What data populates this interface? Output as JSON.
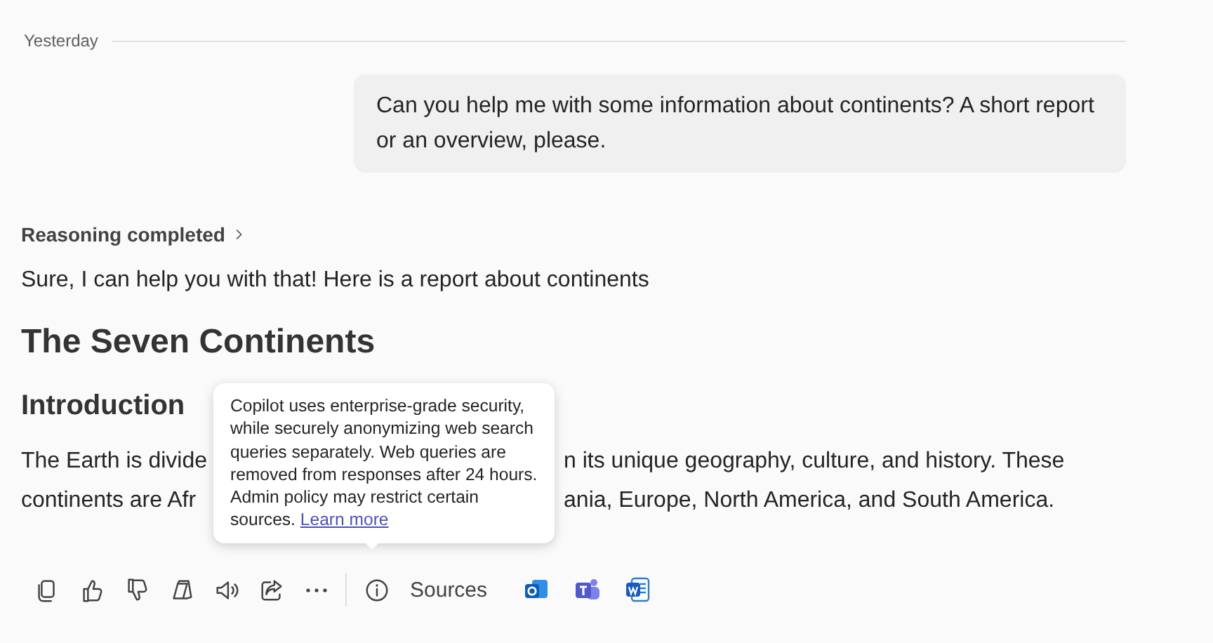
{
  "date_divider": "Yesterday",
  "user_message": "Can you help me with some information about continents? A short report or an overview, please.",
  "reasoning": {
    "label": "Reasoning completed",
    "expanded": false
  },
  "reply": {
    "intro": "Sure, I can help you with that! Here is a report about continents",
    "title": "The Seven Continents",
    "section_heading": "Introduction",
    "paragraph_lines": [
      {
        "left": "The Earth is divide",
        "right": "n its unique geography, culture, and history. These"
      },
      {
        "left": "continents are Afr",
        "right": "ania, Europe, North America, and South America."
      }
    ]
  },
  "tooltip": {
    "text": "Copilot uses enterprise-grade security, while securely anonymizing web search queries separately. Web queries are removed from responses after 24 hours. Admin policy may restrict certain sources.",
    "link": "Learn more"
  },
  "toolbar": {
    "actions": [
      {
        "kind": "copy"
      },
      {
        "kind": "like"
      },
      {
        "kind": "dislike"
      },
      {
        "kind": "pages"
      },
      {
        "kind": "speaker"
      },
      {
        "kind": "share"
      },
      {
        "kind": "more"
      }
    ],
    "sources_label": "Sources",
    "sources": [
      {
        "kind": "mail"
      },
      {
        "kind": "chat"
      },
      {
        "kind": "document"
      }
    ]
  }
}
